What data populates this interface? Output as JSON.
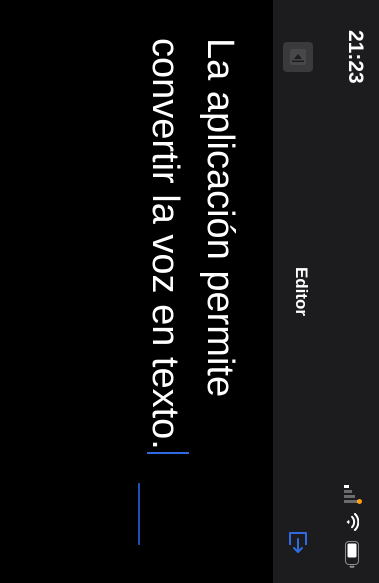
{
  "status": {
    "time": "21:23"
  },
  "nav": {
    "title": "Editor",
    "back_icon": "sidebar-back-icon",
    "action_icon": "share-export-icon"
  },
  "editor": {
    "text": "La aplicación permite convertir la voz en texto."
  },
  "colors": {
    "accent": "#2f6ae0",
    "bar_background": "#1c1c1e",
    "background": "#000000",
    "indicator": "#ff9f0a"
  }
}
